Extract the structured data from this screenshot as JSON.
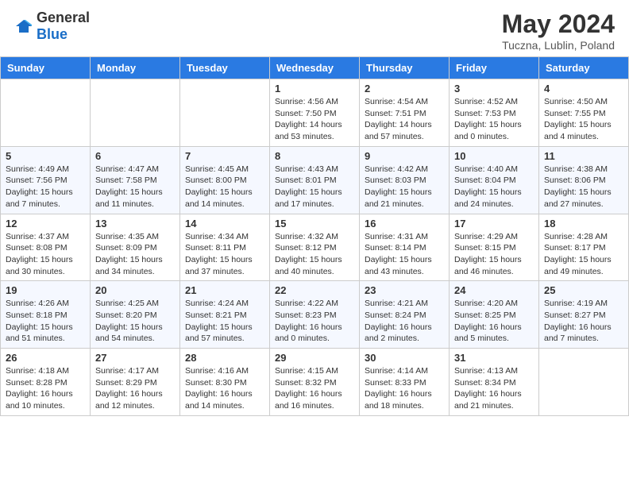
{
  "logo": {
    "general": "General",
    "blue": "Blue"
  },
  "title": {
    "month": "May 2024",
    "location": "Tuczna, Lublin, Poland"
  },
  "weekdays": [
    "Sunday",
    "Monday",
    "Tuesday",
    "Wednesday",
    "Thursday",
    "Friday",
    "Saturday"
  ],
  "weeks": [
    [
      {
        "day": "",
        "sunrise": "",
        "sunset": "",
        "daylight": ""
      },
      {
        "day": "",
        "sunrise": "",
        "sunset": "",
        "daylight": ""
      },
      {
        "day": "",
        "sunrise": "",
        "sunset": "",
        "daylight": ""
      },
      {
        "day": "1",
        "sunrise": "Sunrise: 4:56 AM",
        "sunset": "Sunset: 7:50 PM",
        "daylight": "Daylight: 14 hours and 53 minutes."
      },
      {
        "day": "2",
        "sunrise": "Sunrise: 4:54 AM",
        "sunset": "Sunset: 7:51 PM",
        "daylight": "Daylight: 14 hours and 57 minutes."
      },
      {
        "day": "3",
        "sunrise": "Sunrise: 4:52 AM",
        "sunset": "Sunset: 7:53 PM",
        "daylight": "Daylight: 15 hours and 0 minutes."
      },
      {
        "day": "4",
        "sunrise": "Sunrise: 4:50 AM",
        "sunset": "Sunset: 7:55 PM",
        "daylight": "Daylight: 15 hours and 4 minutes."
      }
    ],
    [
      {
        "day": "5",
        "sunrise": "Sunrise: 4:49 AM",
        "sunset": "Sunset: 7:56 PM",
        "daylight": "Daylight: 15 hours and 7 minutes."
      },
      {
        "day": "6",
        "sunrise": "Sunrise: 4:47 AM",
        "sunset": "Sunset: 7:58 PM",
        "daylight": "Daylight: 15 hours and 11 minutes."
      },
      {
        "day": "7",
        "sunrise": "Sunrise: 4:45 AM",
        "sunset": "Sunset: 8:00 PM",
        "daylight": "Daylight: 15 hours and 14 minutes."
      },
      {
        "day": "8",
        "sunrise": "Sunrise: 4:43 AM",
        "sunset": "Sunset: 8:01 PM",
        "daylight": "Daylight: 15 hours and 17 minutes."
      },
      {
        "day": "9",
        "sunrise": "Sunrise: 4:42 AM",
        "sunset": "Sunset: 8:03 PM",
        "daylight": "Daylight: 15 hours and 21 minutes."
      },
      {
        "day": "10",
        "sunrise": "Sunrise: 4:40 AM",
        "sunset": "Sunset: 8:04 PM",
        "daylight": "Daylight: 15 hours and 24 minutes."
      },
      {
        "day": "11",
        "sunrise": "Sunrise: 4:38 AM",
        "sunset": "Sunset: 8:06 PM",
        "daylight": "Daylight: 15 hours and 27 minutes."
      }
    ],
    [
      {
        "day": "12",
        "sunrise": "Sunrise: 4:37 AM",
        "sunset": "Sunset: 8:08 PM",
        "daylight": "Daylight: 15 hours and 30 minutes."
      },
      {
        "day": "13",
        "sunrise": "Sunrise: 4:35 AM",
        "sunset": "Sunset: 8:09 PM",
        "daylight": "Daylight: 15 hours and 34 minutes."
      },
      {
        "day": "14",
        "sunrise": "Sunrise: 4:34 AM",
        "sunset": "Sunset: 8:11 PM",
        "daylight": "Daylight: 15 hours and 37 minutes."
      },
      {
        "day": "15",
        "sunrise": "Sunrise: 4:32 AM",
        "sunset": "Sunset: 8:12 PM",
        "daylight": "Daylight: 15 hours and 40 minutes."
      },
      {
        "day": "16",
        "sunrise": "Sunrise: 4:31 AM",
        "sunset": "Sunset: 8:14 PM",
        "daylight": "Daylight: 15 hours and 43 minutes."
      },
      {
        "day": "17",
        "sunrise": "Sunrise: 4:29 AM",
        "sunset": "Sunset: 8:15 PM",
        "daylight": "Daylight: 15 hours and 46 minutes."
      },
      {
        "day": "18",
        "sunrise": "Sunrise: 4:28 AM",
        "sunset": "Sunset: 8:17 PM",
        "daylight": "Daylight: 15 hours and 49 minutes."
      }
    ],
    [
      {
        "day": "19",
        "sunrise": "Sunrise: 4:26 AM",
        "sunset": "Sunset: 8:18 PM",
        "daylight": "Daylight: 15 hours and 51 minutes."
      },
      {
        "day": "20",
        "sunrise": "Sunrise: 4:25 AM",
        "sunset": "Sunset: 8:20 PM",
        "daylight": "Daylight: 15 hours and 54 minutes."
      },
      {
        "day": "21",
        "sunrise": "Sunrise: 4:24 AM",
        "sunset": "Sunset: 8:21 PM",
        "daylight": "Daylight: 15 hours and 57 minutes."
      },
      {
        "day": "22",
        "sunrise": "Sunrise: 4:22 AM",
        "sunset": "Sunset: 8:23 PM",
        "daylight": "Daylight: 16 hours and 0 minutes."
      },
      {
        "day": "23",
        "sunrise": "Sunrise: 4:21 AM",
        "sunset": "Sunset: 8:24 PM",
        "daylight": "Daylight: 16 hours and 2 minutes."
      },
      {
        "day": "24",
        "sunrise": "Sunrise: 4:20 AM",
        "sunset": "Sunset: 8:25 PM",
        "daylight": "Daylight: 16 hours and 5 minutes."
      },
      {
        "day": "25",
        "sunrise": "Sunrise: 4:19 AM",
        "sunset": "Sunset: 8:27 PM",
        "daylight": "Daylight: 16 hours and 7 minutes."
      }
    ],
    [
      {
        "day": "26",
        "sunrise": "Sunrise: 4:18 AM",
        "sunset": "Sunset: 8:28 PM",
        "daylight": "Daylight: 16 hours and 10 minutes."
      },
      {
        "day": "27",
        "sunrise": "Sunrise: 4:17 AM",
        "sunset": "Sunset: 8:29 PM",
        "daylight": "Daylight: 16 hours and 12 minutes."
      },
      {
        "day": "28",
        "sunrise": "Sunrise: 4:16 AM",
        "sunset": "Sunset: 8:30 PM",
        "daylight": "Daylight: 16 hours and 14 minutes."
      },
      {
        "day": "29",
        "sunrise": "Sunrise: 4:15 AM",
        "sunset": "Sunset: 8:32 PM",
        "daylight": "Daylight: 16 hours and 16 minutes."
      },
      {
        "day": "30",
        "sunrise": "Sunrise: 4:14 AM",
        "sunset": "Sunset: 8:33 PM",
        "daylight": "Daylight: 16 hours and 18 minutes."
      },
      {
        "day": "31",
        "sunrise": "Sunrise: 4:13 AM",
        "sunset": "Sunset: 8:34 PM",
        "daylight": "Daylight: 16 hours and 21 minutes."
      },
      {
        "day": "",
        "sunrise": "",
        "sunset": "",
        "daylight": ""
      }
    ]
  ]
}
